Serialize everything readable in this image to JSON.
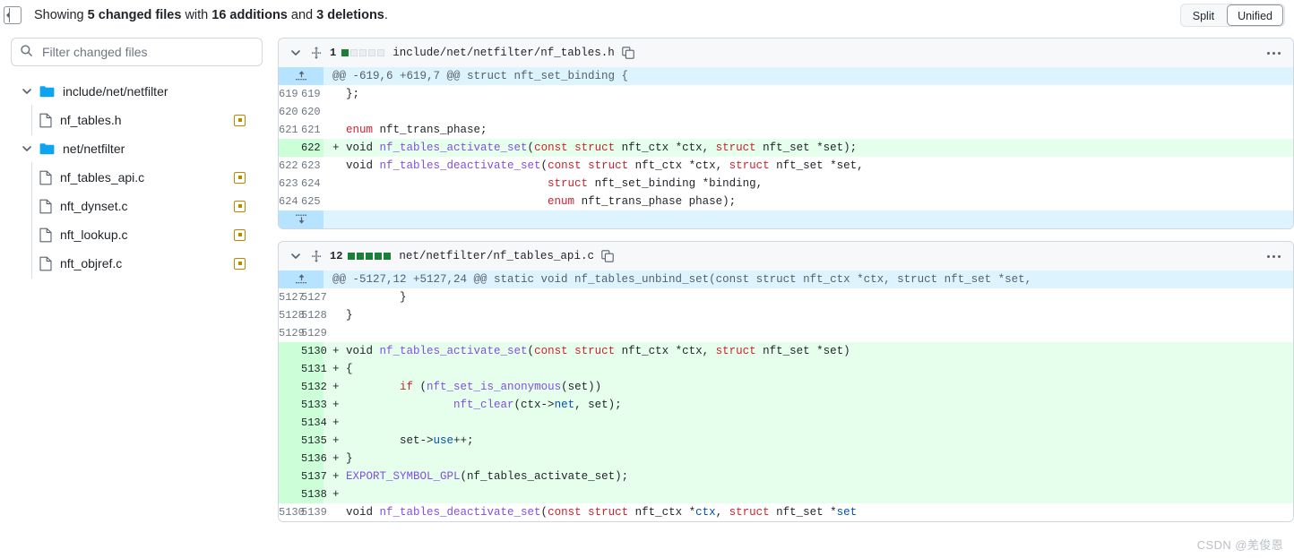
{
  "topbar": {
    "sidebar_toggle_icon": "sidebar-collapse-icon",
    "summary_prefix": "Showing ",
    "summary_files": "5 changed files",
    "summary_mid": " with ",
    "summary_additions": "16 additions",
    "summary_and": " and ",
    "summary_deletions": "3 deletions",
    "summary_end": ".",
    "view_modes": [
      {
        "label": "Split",
        "active": false
      },
      {
        "label": "Unified",
        "active": true
      }
    ]
  },
  "sidebar": {
    "filter": {
      "icon": "search-icon",
      "placeholder": "Filter changed files",
      "value": ""
    },
    "tree": [
      {
        "type": "folder",
        "label": "include/net/netfilter",
        "expanded": true,
        "icon": "folder-icon",
        "chevron": "chevron-down-icon"
      },
      {
        "type": "file",
        "label": "nf_tables.h",
        "icon": "file-icon",
        "status": "modified",
        "status_icon": "modified-status-icon"
      },
      {
        "type": "folder",
        "label": "net/netfilter",
        "expanded": true,
        "icon": "folder-icon",
        "chevron": "chevron-down-icon"
      },
      {
        "type": "file",
        "label": "nf_tables_api.c",
        "icon": "file-icon",
        "status": "modified",
        "status_icon": "modified-status-icon"
      },
      {
        "type": "file",
        "label": "nft_dynset.c",
        "icon": "file-icon",
        "status": "modified",
        "status_icon": "modified-status-icon"
      },
      {
        "type": "file",
        "label": "nft_lookup.c",
        "icon": "file-icon",
        "status": "modified",
        "status_icon": "modified-status-icon"
      },
      {
        "type": "file",
        "label": "nft_objref.c",
        "icon": "file-icon",
        "status": "modified",
        "status_icon": "modified-status-icon"
      }
    ]
  },
  "diff_files": [
    {
      "path": "include/net/netfilter/nf_tables.h",
      "change_count": "1",
      "diffstat": {
        "added_blocks": 1,
        "neutral_blocks": 4
      },
      "collapse_icon": "chevron-down-icon",
      "drag_icon": "drag-handle-icon",
      "copy_icon": "copy-path-icon",
      "menu_icon": "kebab-menu-icon",
      "hunks": [
        {
          "header": "@@ -619,6 +619,7 @@ struct nft_set_binding {",
          "expand_icon": "expand-up-icon",
          "rows": [
            {
              "type": "ctx",
              "old": "619",
              "new": "619",
              "code": "  };"
            },
            {
              "type": "ctx",
              "old": "620",
              "new": "620",
              "code": "  "
            },
            {
              "type": "ctx",
              "old": "621",
              "new": "621",
              "code": "  enum nft_trans_phase;"
            },
            {
              "type": "add",
              "old": "",
              "new": "622",
              "code": "+ void nf_tables_activate_set(const struct nft_ctx *ctx, struct nft_set *set);"
            },
            {
              "type": "ctx",
              "old": "622",
              "new": "623",
              "code": "  void nf_tables_deactivate_set(const struct nft_ctx *ctx, struct nft_set *set,"
            },
            {
              "type": "ctx",
              "old": "623",
              "new": "624",
              "code": "                                struct nft_set_binding *binding,"
            },
            {
              "type": "ctx",
              "old": "624",
              "new": "625",
              "code": "                                enum nft_trans_phase phase);"
            }
          ],
          "expand_down_icon": "expand-down-icon"
        }
      ]
    },
    {
      "path": "net/netfilter/nf_tables_api.c",
      "change_count": "12",
      "diffstat": {
        "added_blocks": 5,
        "neutral_blocks": 0
      },
      "collapse_icon": "chevron-down-icon",
      "drag_icon": "drag-handle-icon",
      "copy_icon": "copy-path-icon",
      "menu_icon": "kebab-menu-icon",
      "hunks": [
        {
          "header": "@@ -5127,12 +5127,24 @@ static void nf_tables_unbind_set(const struct nft_ctx *ctx, struct nft_set *set,",
          "expand_icon": "expand-up-icon",
          "rows": [
            {
              "type": "ctx",
              "old": "5127",
              "new": "5127",
              "code": "          }"
            },
            {
              "type": "ctx",
              "old": "5128",
              "new": "5128",
              "code": "  }"
            },
            {
              "type": "ctx",
              "old": "5129",
              "new": "5129",
              "code": "  "
            },
            {
              "type": "add",
              "old": "",
              "new": "5130",
              "code": "+ void nf_tables_activate_set(const struct nft_ctx *ctx, struct nft_set *set)"
            },
            {
              "type": "add",
              "old": "",
              "new": "5131",
              "code": "+ {"
            },
            {
              "type": "add",
              "old": "",
              "new": "5132",
              "code": "+         if (nft_set_is_anonymous(set))"
            },
            {
              "type": "add",
              "old": "",
              "new": "5133",
              "code": "+                 nft_clear(ctx->net, set);"
            },
            {
              "type": "add",
              "old": "",
              "new": "5134",
              "code": "+ "
            },
            {
              "type": "add",
              "old": "",
              "new": "5135",
              "code": "+         set->use++;"
            },
            {
              "type": "add",
              "old": "",
              "new": "5136",
              "code": "+ }"
            },
            {
              "type": "add",
              "old": "",
              "new": "5137",
              "code": "+ EXPORT_SYMBOL_GPL(nf_tables_activate_set);"
            },
            {
              "type": "add",
              "old": "",
              "new": "5138",
              "code": "+ "
            },
            {
              "type": "ctx",
              "old": "5130",
              "new": "5139",
              "code": "  void nf_tables_deactivate_set(const struct nft_ctx *ctx, struct nft_set *set"
            }
          ]
        }
      ]
    }
  ],
  "watermark": "CSDN @羌俊恩",
  "colors": {
    "add_bg": "#e6ffec",
    "add_gutter": "#ccffd8",
    "hunk_bg": "#ddf4ff",
    "hunk_gutter": "#b6e3ff",
    "diffstat_add": "#1a7f37",
    "status_modified": "#bf8700",
    "folder_blue": "#0ea5f0",
    "border": "#d0d7de"
  }
}
